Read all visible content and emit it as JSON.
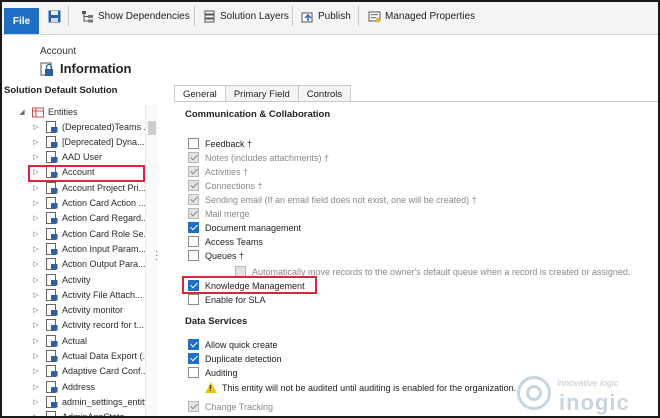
{
  "ribbon": {
    "file_label": "File",
    "show_dependencies": "Show Dependencies",
    "solution_layers": "Solution Layers",
    "publish": "Publish",
    "managed_properties": "Managed Properties"
  },
  "header": {
    "entity_name": "Account",
    "section_title": "Information"
  },
  "left_panel": {
    "title": "Solution Default Solution",
    "root_label": "Entities",
    "items": [
      {
        "label": "(Deprecated)Teams ..."
      },
      {
        "label": "[Deprecated] Dyna..."
      },
      {
        "label": "AAD User"
      },
      {
        "label": "Account"
      },
      {
        "label": "Account Project Pri..."
      },
      {
        "label": "Action Card Action ..."
      },
      {
        "label": "Action Card Regard..."
      },
      {
        "label": "Action Card Role Se..."
      },
      {
        "label": "Action Input Param..."
      },
      {
        "label": "Action Output Para..."
      },
      {
        "label": "Activity"
      },
      {
        "label": "Activity File Attach..."
      },
      {
        "label": "Activity monitor"
      },
      {
        "label": "Activity record for t..."
      },
      {
        "label": "Actual"
      },
      {
        "label": "Actual Data Export (..."
      },
      {
        "label": "Adaptive Card Conf..."
      },
      {
        "label": "Address"
      },
      {
        "label": "admin_settings_entity"
      },
      {
        "label": "AdminAppState"
      }
    ]
  },
  "tabs": [
    {
      "label": "General",
      "active": true
    },
    {
      "label": "Primary Field",
      "active": false
    },
    {
      "label": "Controls",
      "active": false
    }
  ],
  "communication": {
    "title": "Communication & Collaboration",
    "options": [
      {
        "label": "Feedback †",
        "checked": false,
        "disabled": false
      },
      {
        "label": "Notes (includes attachments) †",
        "checked": true,
        "disabled": true
      },
      {
        "label": "Activities †",
        "checked": true,
        "disabled": true
      },
      {
        "label": "Connections †",
        "checked": true,
        "disabled": true
      },
      {
        "label": "Sending email (If an email field does not exist, one will be created) †",
        "checked": true,
        "disabled": true
      },
      {
        "label": "Mail merge",
        "checked": true,
        "disabled": true
      },
      {
        "label": "Document management",
        "checked": true,
        "disabled": false
      },
      {
        "label": "Access Teams",
        "checked": false,
        "disabled": false
      },
      {
        "label": "Queues †",
        "checked": false,
        "disabled": false
      },
      {
        "label": "Automatically move records to the owner's default queue when a record is created or assigned.",
        "checked": false,
        "disabled": true
      },
      {
        "label": "Knowledge Management",
        "checked": true,
        "disabled": false
      },
      {
        "label": "Enable for SLA",
        "checked": false,
        "disabled": false
      }
    ]
  },
  "data_services": {
    "title": "Data Services",
    "options": [
      {
        "label": "Allow quick create",
        "checked": true,
        "disabled": false
      },
      {
        "label": "Duplicate detection",
        "checked": true,
        "disabled": false
      },
      {
        "label": "Auditing",
        "checked": false,
        "disabled": false
      },
      {
        "label": "Change Tracking",
        "checked": true,
        "disabled": true
      }
    ],
    "auditing_warning": "This entity will not be audited until auditing is enabled for the organization."
  },
  "watermark": {
    "tagline": "innovative logic",
    "word": "inogic"
  },
  "colors": {
    "accent": "#1f6fc5",
    "highlight_box": "#e0223b",
    "warning": "#f2c21a"
  }
}
